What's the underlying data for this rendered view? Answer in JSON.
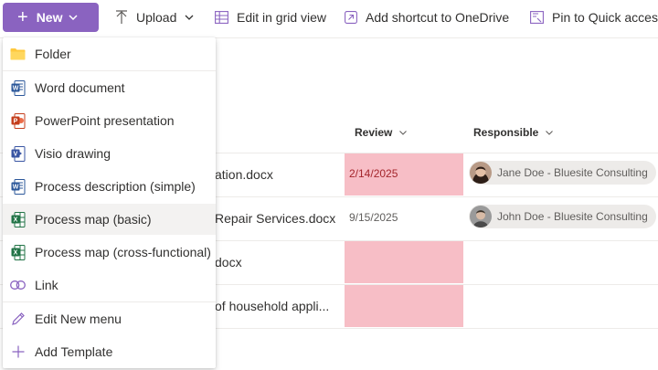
{
  "toolbar": {
    "new_label": "New",
    "upload_label": "Upload",
    "grid_label": "Edit in grid view",
    "shortcut_label": "Add shortcut to OneDrive",
    "pin_label": "Pin to Quick access"
  },
  "columns": {
    "review": "Review",
    "responsible": "Responsible"
  },
  "rows": [
    {
      "name": "ation.docx",
      "review": "2/14/2025",
      "review_highlight": true,
      "person": "Jane Doe - Bluesite Consulting"
    },
    {
      "name": "Repair Services.docx",
      "review": "9/15/2025",
      "review_highlight": false,
      "person": "John Doe - Bluesite Consulting"
    },
    {
      "name": "docx",
      "review": "",
      "review_highlight": true,
      "person": ""
    },
    {
      "name": "of household appli...",
      "review": "",
      "review_highlight": true,
      "person": ""
    }
  ],
  "menu": {
    "items": [
      {
        "label": "Folder",
        "icon": "folder-icon"
      },
      {
        "label": "Word document",
        "icon": "word-icon"
      },
      {
        "label": "PowerPoint presentation",
        "icon": "powerpoint-icon"
      },
      {
        "label": "Visio drawing",
        "icon": "visio-icon"
      },
      {
        "label": "Process description (simple)",
        "icon": "word-icon"
      },
      {
        "label": "Process map (basic)",
        "icon": "excel-icon"
      },
      {
        "label": "Process map (cross-functional)",
        "icon": "excel-icon"
      },
      {
        "label": "Link",
        "icon": "link-icon"
      },
      {
        "label": "Edit New menu",
        "icon": "pencil-icon"
      },
      {
        "label": "Add Template",
        "icon": "plus-icon"
      }
    ]
  },
  "colors": {
    "brand": "#8a63c0",
    "review_highlight": "#f7bec6",
    "review_overdue_text": "#a4262c",
    "word": "#2b579a",
    "powerpoint": "#c43e1c",
    "visio": "#3955a3",
    "excel": "#217346"
  }
}
